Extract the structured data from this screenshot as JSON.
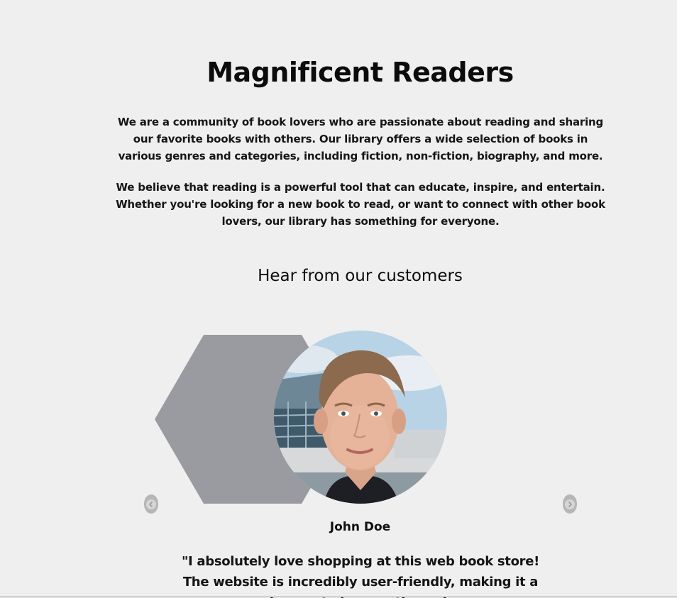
{
  "header": {
    "title": "Magnificent Readers"
  },
  "intro": {
    "paragraph1": "We are a community of book lovers who are passionate about reading and sharing our favorite books with others. Our library offers a wide selection of books in various genres and categories, including fiction, non-fiction, biography, and more.",
    "paragraph2": "We believe that reading is a powerful tool that can educate, inspire, and entertain. Whether you're looking for a new book to read, or want to connect with other book lovers, our library has something for everyone."
  },
  "testimonials": {
    "heading": "Hear from our customers",
    "current": {
      "name": "John Doe",
      "quote": "\"I absolutely love shopping at this web book store! The website is incredibly user-friendly, making it a breeze to browse through"
    },
    "prev_icon": "chevron-left-icon",
    "next_icon": "chevron-right-icon"
  },
  "colors": {
    "background": "#efefef",
    "hexagon": "#9a9aa1",
    "nav_button": "#b6b6b6"
  }
}
